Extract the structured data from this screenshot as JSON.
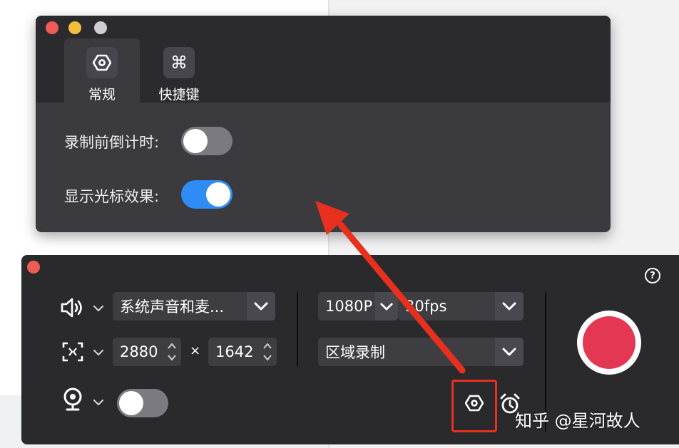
{
  "preferences": {
    "tabs": [
      {
        "label": "常规",
        "icon": "settings-hexagon-icon",
        "active": true
      },
      {
        "label": "快捷键",
        "icon": "command-key-icon",
        "active": false
      }
    ],
    "countdown_label": "录制前倒计时:",
    "countdown_enabled": false,
    "cursor_effect_label": "显示光标效果:",
    "cursor_effect_enabled": true,
    "toggle_on_color": "#2f8cf5",
    "toggle_off_color": "#7a7a80"
  },
  "recorder": {
    "audio_source": "系统声音和麦...",
    "width": "2880",
    "times_sign": "×",
    "height": "1642",
    "resolution": "1080P",
    "fps": "30fps",
    "record_mode": "区域录制",
    "help_label": "?",
    "camera_enabled": false,
    "record_button_color": "#e33754"
  },
  "annotation": {
    "arrow_color": "#e8301e"
  },
  "watermark": "知乎 @星河故人"
}
